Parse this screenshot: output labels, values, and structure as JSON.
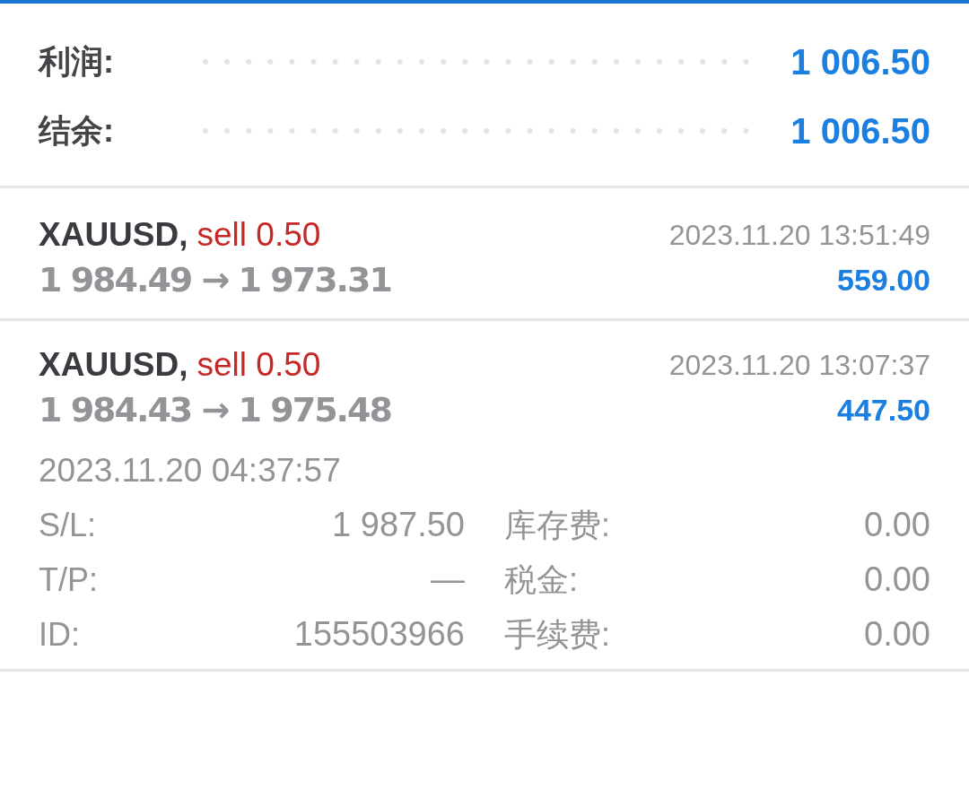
{
  "summary": [
    {
      "label": "利润:",
      "value": "1 006.50"
    },
    {
      "label": "结余:",
      "value": "1 006.50"
    }
  ],
  "trades": [
    {
      "symbol": "XAUUSD,",
      "order": "sell 0.50",
      "prices": "1 984.49 → 1 973.31",
      "close_time": "2023.11.20 13:51:49",
      "profit": "559.00",
      "expanded": false
    },
    {
      "symbol": "XAUUSD,",
      "order": "sell 0.50",
      "prices": "1 984.43 → 1 975.48",
      "close_time": "2023.11.20 13:07:37",
      "profit": "447.50",
      "expanded": true,
      "open_time": "2023.11.20 04:37:57",
      "details": [
        {
          "label": "S/L:",
          "value": "1 987.50"
        },
        {
          "label": "库存费:",
          "value": "0.00"
        },
        {
          "label": "T/P:",
          "value": "—"
        },
        {
          "label": "税金:",
          "value": "0.00"
        },
        {
          "label": "ID:",
          "value": "155503966"
        },
        {
          "label": "手续费:",
          "value": "0.00"
        }
      ]
    }
  ]
}
